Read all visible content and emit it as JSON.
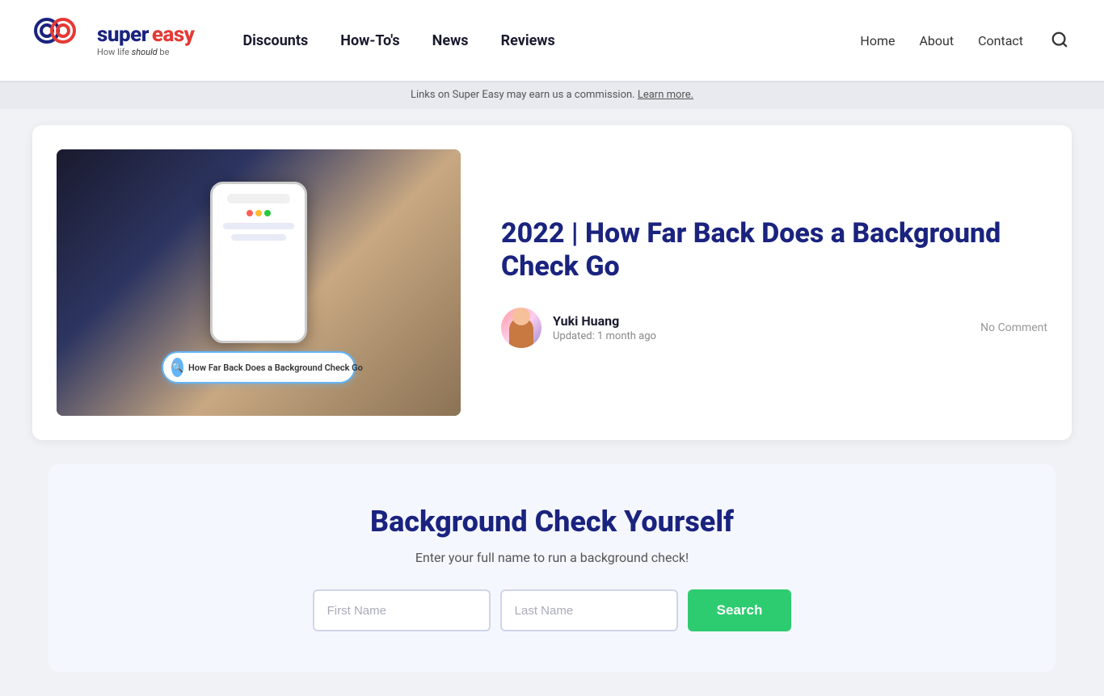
{
  "header": {
    "logo": {
      "super_text": "super",
      "easy_text": "easy",
      "tagline": "How life should be"
    },
    "main_nav": {
      "items": [
        {
          "label": "Discounts",
          "id": "discounts"
        },
        {
          "label": "How-To's",
          "id": "howtos"
        },
        {
          "label": "News",
          "id": "news"
        },
        {
          "label": "Reviews",
          "id": "reviews"
        }
      ]
    },
    "secondary_nav": {
      "items": [
        {
          "label": "Home",
          "id": "home"
        },
        {
          "label": "About",
          "id": "about"
        },
        {
          "label": "Contact",
          "id": "contact"
        }
      ]
    }
  },
  "notice_bar": {
    "text": "Links on Super Easy may earn us a commission.",
    "link_text": "Learn more."
  },
  "article": {
    "title": "2022 | How Far Back Does a Background Check Go",
    "image_alt": "How Far Back Does a Background Check Go",
    "search_bubble_text": "How Far Back Does a Background Check Go",
    "author": {
      "name": "Yuki Huang",
      "updated": "Updated: 1 month ago"
    },
    "comment_count": "No Comment"
  },
  "bg_check_widget": {
    "title": "Background Check Yourself",
    "subtitle": "Enter your full name to run a background check!",
    "first_name_placeholder": "First Name",
    "last_name_placeholder": "Last Name",
    "button_label": "Search"
  },
  "phone_dots": [
    {
      "color": "#ff5f57"
    },
    {
      "color": "#ffbd2e"
    },
    {
      "color": "#28c840"
    }
  ]
}
